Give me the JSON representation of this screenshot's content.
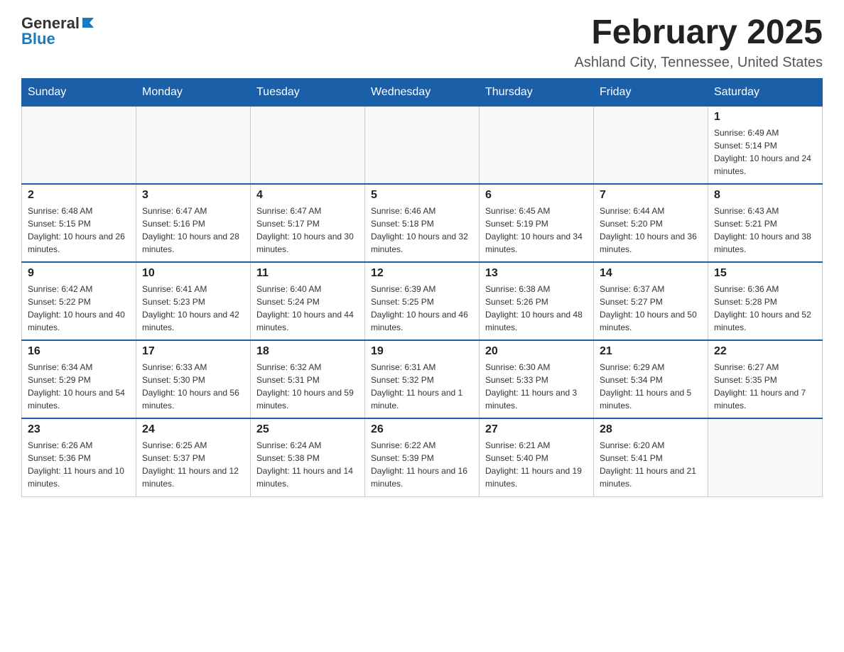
{
  "header": {
    "logo_general": "General",
    "logo_blue": "Blue",
    "month_title": "February 2025",
    "location": "Ashland City, Tennessee, United States"
  },
  "weekdays": [
    "Sunday",
    "Monday",
    "Tuesday",
    "Wednesday",
    "Thursday",
    "Friday",
    "Saturday"
  ],
  "weeks": [
    [
      {
        "day": "",
        "info": ""
      },
      {
        "day": "",
        "info": ""
      },
      {
        "day": "",
        "info": ""
      },
      {
        "day": "",
        "info": ""
      },
      {
        "day": "",
        "info": ""
      },
      {
        "day": "",
        "info": ""
      },
      {
        "day": "1",
        "info": "Sunrise: 6:49 AM\nSunset: 5:14 PM\nDaylight: 10 hours and 24 minutes."
      }
    ],
    [
      {
        "day": "2",
        "info": "Sunrise: 6:48 AM\nSunset: 5:15 PM\nDaylight: 10 hours and 26 minutes."
      },
      {
        "day": "3",
        "info": "Sunrise: 6:47 AM\nSunset: 5:16 PM\nDaylight: 10 hours and 28 minutes."
      },
      {
        "day": "4",
        "info": "Sunrise: 6:47 AM\nSunset: 5:17 PM\nDaylight: 10 hours and 30 minutes."
      },
      {
        "day": "5",
        "info": "Sunrise: 6:46 AM\nSunset: 5:18 PM\nDaylight: 10 hours and 32 minutes."
      },
      {
        "day": "6",
        "info": "Sunrise: 6:45 AM\nSunset: 5:19 PM\nDaylight: 10 hours and 34 minutes."
      },
      {
        "day": "7",
        "info": "Sunrise: 6:44 AM\nSunset: 5:20 PM\nDaylight: 10 hours and 36 minutes."
      },
      {
        "day": "8",
        "info": "Sunrise: 6:43 AM\nSunset: 5:21 PM\nDaylight: 10 hours and 38 minutes."
      }
    ],
    [
      {
        "day": "9",
        "info": "Sunrise: 6:42 AM\nSunset: 5:22 PM\nDaylight: 10 hours and 40 minutes."
      },
      {
        "day": "10",
        "info": "Sunrise: 6:41 AM\nSunset: 5:23 PM\nDaylight: 10 hours and 42 minutes."
      },
      {
        "day": "11",
        "info": "Sunrise: 6:40 AM\nSunset: 5:24 PM\nDaylight: 10 hours and 44 minutes."
      },
      {
        "day": "12",
        "info": "Sunrise: 6:39 AM\nSunset: 5:25 PM\nDaylight: 10 hours and 46 minutes."
      },
      {
        "day": "13",
        "info": "Sunrise: 6:38 AM\nSunset: 5:26 PM\nDaylight: 10 hours and 48 minutes."
      },
      {
        "day": "14",
        "info": "Sunrise: 6:37 AM\nSunset: 5:27 PM\nDaylight: 10 hours and 50 minutes."
      },
      {
        "day": "15",
        "info": "Sunrise: 6:36 AM\nSunset: 5:28 PM\nDaylight: 10 hours and 52 minutes."
      }
    ],
    [
      {
        "day": "16",
        "info": "Sunrise: 6:34 AM\nSunset: 5:29 PM\nDaylight: 10 hours and 54 minutes."
      },
      {
        "day": "17",
        "info": "Sunrise: 6:33 AM\nSunset: 5:30 PM\nDaylight: 10 hours and 56 minutes."
      },
      {
        "day": "18",
        "info": "Sunrise: 6:32 AM\nSunset: 5:31 PM\nDaylight: 10 hours and 59 minutes."
      },
      {
        "day": "19",
        "info": "Sunrise: 6:31 AM\nSunset: 5:32 PM\nDaylight: 11 hours and 1 minute."
      },
      {
        "day": "20",
        "info": "Sunrise: 6:30 AM\nSunset: 5:33 PM\nDaylight: 11 hours and 3 minutes."
      },
      {
        "day": "21",
        "info": "Sunrise: 6:29 AM\nSunset: 5:34 PM\nDaylight: 11 hours and 5 minutes."
      },
      {
        "day": "22",
        "info": "Sunrise: 6:27 AM\nSunset: 5:35 PM\nDaylight: 11 hours and 7 minutes."
      }
    ],
    [
      {
        "day": "23",
        "info": "Sunrise: 6:26 AM\nSunset: 5:36 PM\nDaylight: 11 hours and 10 minutes."
      },
      {
        "day": "24",
        "info": "Sunrise: 6:25 AM\nSunset: 5:37 PM\nDaylight: 11 hours and 12 minutes."
      },
      {
        "day": "25",
        "info": "Sunrise: 6:24 AM\nSunset: 5:38 PM\nDaylight: 11 hours and 14 minutes."
      },
      {
        "day": "26",
        "info": "Sunrise: 6:22 AM\nSunset: 5:39 PM\nDaylight: 11 hours and 16 minutes."
      },
      {
        "day": "27",
        "info": "Sunrise: 6:21 AM\nSunset: 5:40 PM\nDaylight: 11 hours and 19 minutes."
      },
      {
        "day": "28",
        "info": "Sunrise: 6:20 AM\nSunset: 5:41 PM\nDaylight: 11 hours and 21 minutes."
      },
      {
        "day": "",
        "info": ""
      }
    ]
  ]
}
